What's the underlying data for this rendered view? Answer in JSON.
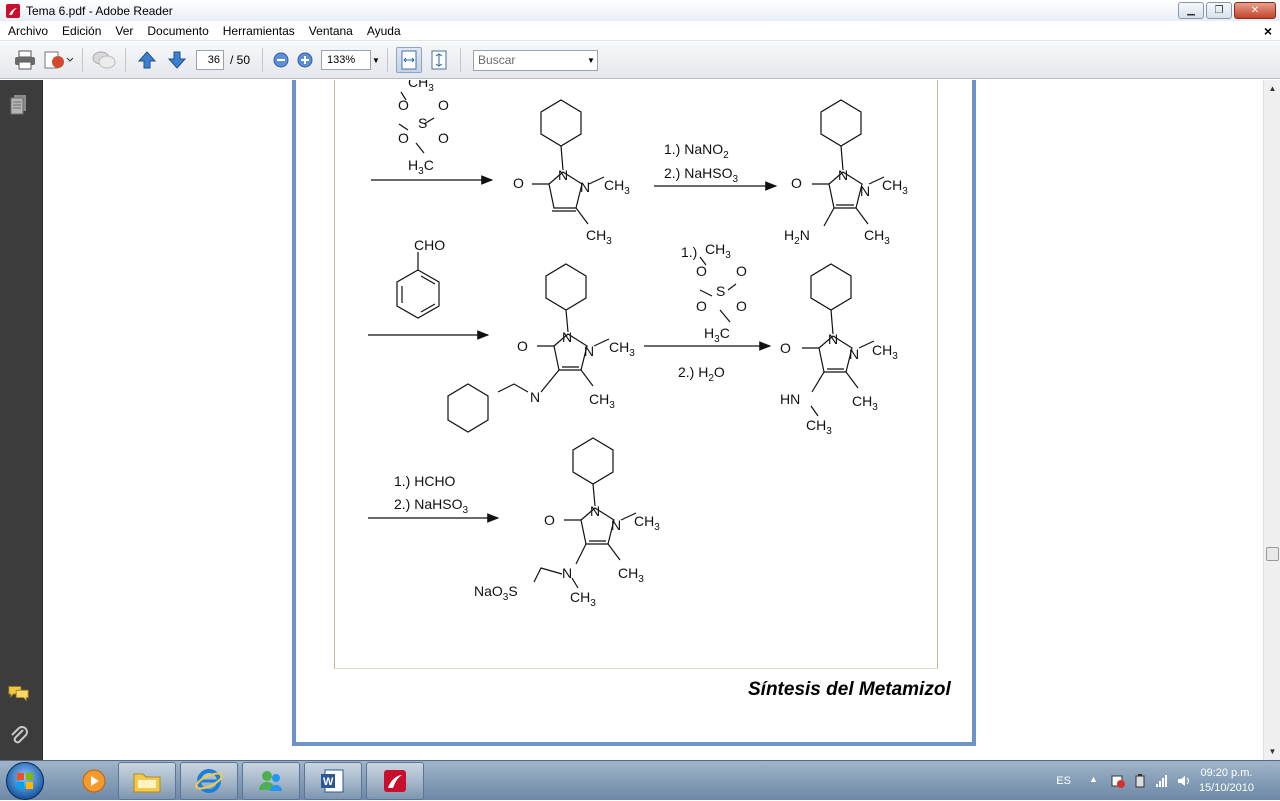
{
  "window": {
    "title": "Tema 6.pdf - Adobe Reader"
  },
  "menu": [
    "Archivo",
    "Edición",
    "Ver",
    "Documento",
    "Herramientas",
    "Ventana",
    "Ayuda"
  ],
  "toolbar": {
    "page_current": "36",
    "page_total": "/ 50",
    "zoom": "133%",
    "search_placeholder": "Buscar"
  },
  "document": {
    "caption": "Síntesis del Metamizol",
    "labels": {
      "ch3": "CH",
      "sub3": "3",
      "h3c": "H",
      "c": "C",
      "o": "O",
      "s": "S",
      "n": "N",
      "h2n": "H",
      "sub2": "2",
      "cho": "CHO",
      "hn": "HN",
      "nao3s": "NaO",
      "step1a": "1.) NaNO",
      "step1b": "2.) NaHSO",
      "step2a": "1.)",
      "step2b": "2.) H",
      "step3a": "1.) HCHO",
      "step3b": "2.) NaHSO"
    }
  },
  "taskbar": {
    "lang": "ES",
    "time": "09:20 p.m.",
    "date": "15/10/2010"
  },
  "colors": {
    "page_border": "#6f93c7",
    "nav_bg": "#3c3c3c",
    "taskbar": "#7f99b6"
  }
}
